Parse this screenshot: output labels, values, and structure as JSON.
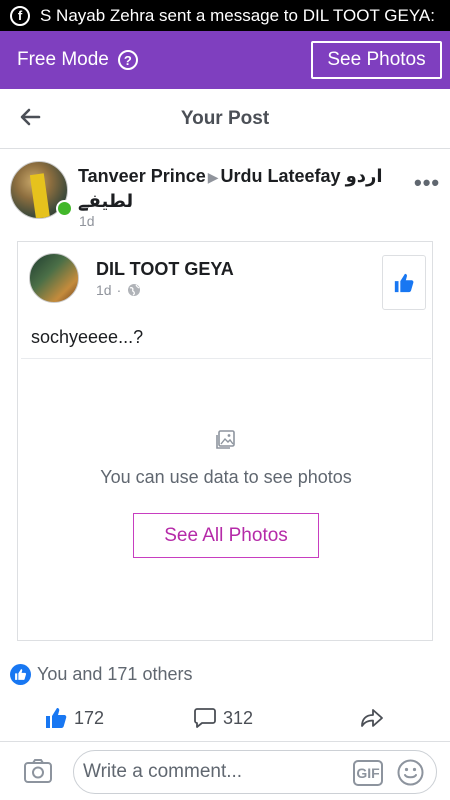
{
  "notification": {
    "icon": "facebook-icon",
    "text": "S Nayab Zehra sent a message to DIL TOOT GEYA:"
  },
  "mode_bar": {
    "label": "Free Mode",
    "help_icon": "question-icon",
    "button_label": "See Photos",
    "color": "#7f3fbf"
  },
  "header": {
    "back_icon": "back-arrow-icon",
    "title": "Your Post"
  },
  "post": {
    "author": "Tanveer Prince",
    "group_prefix": "Urdu Lateefay",
    "group_urdu": "اردو لطیفے",
    "time": "1d",
    "online": true,
    "shared": {
      "page_name": "DIL TOOT GEYA",
      "time": "1d",
      "separator": "·",
      "privacy_icon": "globe-icon",
      "text": "sochyeeee...?",
      "photo_message": "You can use data to see photos",
      "photo_button": "See All Photos"
    },
    "reactions": {
      "summary": "You and 171 others",
      "likes": "172",
      "comments": "312"
    }
  },
  "comment_bar": {
    "placeholder": "Write a comment...",
    "gif_label": "GIF"
  },
  "colors": {
    "accent": "#1877f2",
    "photo_button": "#b52aa8",
    "online": "#42b72a"
  }
}
